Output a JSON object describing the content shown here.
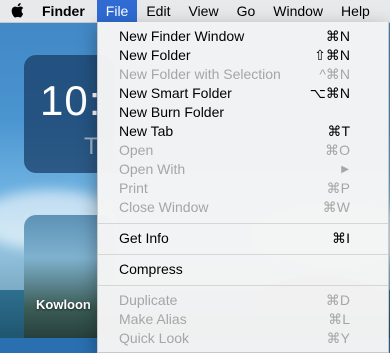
{
  "menubar": {
    "app_name": "Finder",
    "menus": [
      "File",
      "Edit",
      "View",
      "Go",
      "Window",
      "Help"
    ]
  },
  "desktop": {
    "clock_time": "10:",
    "clock_sub": "T",
    "photo_label": "Kowloon"
  },
  "file_menu": {
    "items": [
      {
        "label": "New Finder Window",
        "shortcut": "⌘N"
      },
      {
        "label": "New Folder",
        "shortcut": "⇧⌘N"
      },
      {
        "label": "New Folder with Selection",
        "shortcut": "^⌘N"
      },
      {
        "label": "New Smart Folder",
        "shortcut": "⌥⌘N"
      },
      {
        "label": "New Burn Folder",
        "shortcut": ""
      },
      {
        "label": "New Tab",
        "shortcut": "⌘T"
      },
      {
        "label": "Open",
        "shortcut": "⌘O"
      },
      {
        "label": "Open With",
        "shortcut": ""
      },
      {
        "label": "Print",
        "shortcut": "⌘P"
      },
      {
        "label": "Close Window",
        "shortcut": "⌘W"
      },
      {
        "label": "Get Info",
        "shortcut": "⌘I"
      },
      {
        "label": "Compress",
        "shortcut": ""
      },
      {
        "label": "Duplicate",
        "shortcut": "⌘D"
      },
      {
        "label": "Make Alias",
        "shortcut": "⌘L"
      },
      {
        "label": "Quick Look",
        "shortcut": "⌘Y"
      }
    ]
  },
  "colors": {
    "menu_highlight": "#2f6bd3",
    "disabled_text": "#a6a6a6"
  }
}
